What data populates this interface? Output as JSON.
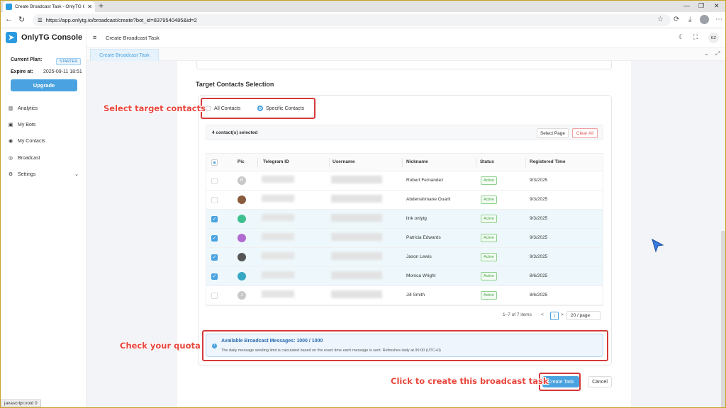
{
  "browser": {
    "tab_title": "Create Broadcast Task - OnlyTG C",
    "url": "https://app.onlytg.io/broadcast/create?bot_id=8379540485&id=2",
    "status_text": "javascript:void 0"
  },
  "sidebar": {
    "brand": "OnlyTG Console",
    "plan_label": "Current Plan:",
    "plan_value": "STARTER",
    "expire_label": "Expire at:",
    "expire_value": "2025-09-11 18:51",
    "upgrade": "Upgrade",
    "items": [
      {
        "label": "Analytics",
        "icon": "chart-icon"
      },
      {
        "label": "My Bots",
        "icon": "bot-icon"
      },
      {
        "label": "My Contacts",
        "icon": "contacts-icon"
      },
      {
        "label": "Broadcast",
        "icon": "broadcast-icon"
      },
      {
        "label": "Settings",
        "icon": "gear-icon"
      }
    ]
  },
  "header": {
    "title": "Create Broadcast Task",
    "avatar": "EZ"
  },
  "page_tab": "Create Broadcast Task",
  "main": {
    "section_title": "Target Contacts Selection",
    "radio_all": "All Contacts",
    "radio_specific": "Specific Contacts",
    "selected_count": "4 contact(s) selected",
    "select_page": "Select Page",
    "clear_all": "Clear All",
    "columns": [
      "Pic",
      "Telegram ID",
      "Username",
      "Nickname",
      "Status",
      "Registered Time"
    ],
    "rows": [
      {
        "nickname": "Robert Fernandez",
        "status": "Active",
        "registered": "9/3/2025",
        "selected": false,
        "pic_color": "#c8c8c8",
        "pic": "R"
      },
      {
        "nickname": "Abderrahmane Ouarti",
        "status": "Active",
        "registered": "9/3/2025",
        "selected": false,
        "pic_color": "#8a5a3c",
        "pic": ""
      },
      {
        "nickname": "link onlytg",
        "status": "Active",
        "registered": "9/3/2025",
        "selected": true,
        "pic_color": "#3fbf8f",
        "pic": ""
      },
      {
        "nickname": "Patricia Edwards",
        "status": "Active",
        "registered": "9/3/2025",
        "selected": true,
        "pic_color": "#b06ad0",
        "pic": ""
      },
      {
        "nickname": "Jason Lewis",
        "status": "Active",
        "registered": "9/3/2025",
        "selected": true,
        "pic_color": "#555555",
        "pic": ""
      },
      {
        "nickname": "Monica Wright",
        "status": "Active",
        "registered": "8/6/2025",
        "selected": true,
        "pic_color": "#35a7c2",
        "pic": ""
      },
      {
        "nickname": "Jill Smith",
        "status": "Active",
        "registered": "8/6/2025",
        "selected": false,
        "pic_color": "#c8c8c8",
        "pic": "J"
      }
    ],
    "pagination": {
      "summary": "1–7 of 7 items",
      "prev": "<",
      "page": "1",
      "next": ">",
      "page_size": "20 / page"
    },
    "quota_title": "Available Broadcast Messages: 1000 / 1000",
    "quota_desc": "The daily message sending limit is calculated based on the exact time each message is sent. Refreshes daily at 00:00 (UTC+0)",
    "create_button": "Create Task",
    "cancel_button": "Cancel"
  },
  "annotations": {
    "select_contacts": "Select target contacts",
    "check_quota": "Check your quota",
    "create_task": "Click to create this broadcast task"
  },
  "colors": {
    "accent": "#4aa3e0",
    "annotation": "#e8453c",
    "highlight_box": "#d43a3a",
    "active_green": "#4aa64a"
  }
}
